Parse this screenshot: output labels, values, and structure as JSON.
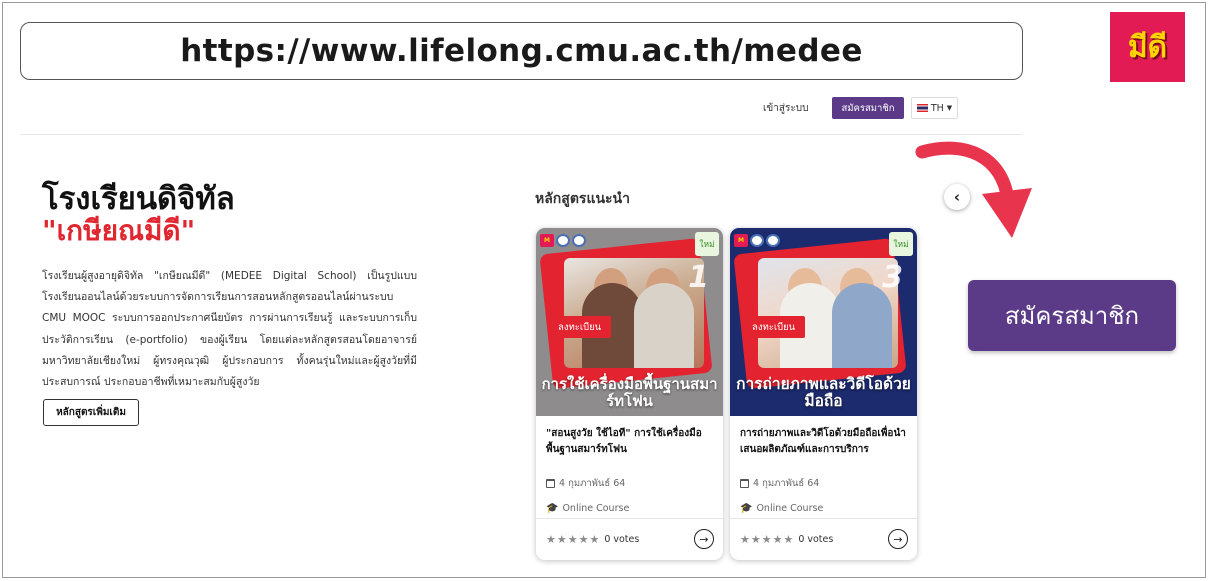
{
  "url_banner": {
    "text": "https://www.lifelong.cmu.ac.th/medee"
  },
  "logo": {
    "text": "มีดี",
    "bg": "#e31b54",
    "fg": "#ffd400"
  },
  "nav": {
    "login": "เข้าสู่ระบบ",
    "register": "สมัครสมาชิก",
    "language": "TH"
  },
  "hero": {
    "title_line1": "โรงเรียนดิจิทัล",
    "title_line2": "\"เกษียณมีดี\"",
    "description": "โรงเรียนผู้สูงอายุดิจิทัล \"เกษียณมีดี\" (MEDEE Digital School) เป็นรูปแบบโรงเรียนออนไลน์ด้วยระบบการจัดการเรียนการสอนหลักสูตรออนไลน์ผ่านระบบ CMU MOOC ระบบการออกประกาศนียบัตร การผ่านการเรียนรู้ และระบบการเก็บประวัติการเรียน (e-portfolio) ของผู้เรียน โดยแต่ละหลักสูตรสอนโดยอาจารย์มหาวิทยาลัยเชียงใหม่ ผู้ทรงคุณวุฒิ ผู้ประกอบการ ทั้งคนรุ่นใหม่และผู้สูงวัยที่มีประสบการณ์ ประกอบอาชีพที่เหมาะสมกับผู้สูงวัย",
    "more_button": "หลักสูตรเพิ่มเติม"
  },
  "recommended": {
    "heading": "หลักสูตรแนะนำ",
    "courses": [
      {
        "badge": "ใหม่",
        "number": "1",
        "enroll": "ลงทะเบียน",
        "image_caption": "การใช้เครื่องมือพื้นฐานสมาร์ทโฟน",
        "title": "\"สอนสูงวัย ใช้ไอที\" การใช้เครื่องมือพื้นฐานสมาร์ทโฟน",
        "date": "4 กุมภาพันธ์ 64",
        "type": "Online Course",
        "stars": "★★★★★",
        "votes": "0 votes"
      },
      {
        "badge": "ใหม่",
        "number": "3",
        "enroll": "ลงทะเบียน",
        "image_caption": "การถ่ายภาพและวิดีโอด้วยมือถือ",
        "title": "การถ่ายภาพและวิดีโอด้วยมือถือเพื่อนำเสนอผลิตภัณฑ์และการบริการ",
        "date": "4 กุมภาพันธ์ 64",
        "type": "Online Course",
        "stars": "★★★★★",
        "votes": "0 votes"
      }
    ]
  },
  "cta": {
    "label": "สมัครสมาชิก",
    "color": "#5b3a87"
  },
  "accent_red": "#e0262f",
  "icons": [
    "chevron-left-icon",
    "calendar-icon",
    "graduation-cap-icon",
    "arrow-right-circle-icon",
    "star-icon",
    "flag-th-icon",
    "caret-down-icon",
    "curved-arrow-icon"
  ]
}
